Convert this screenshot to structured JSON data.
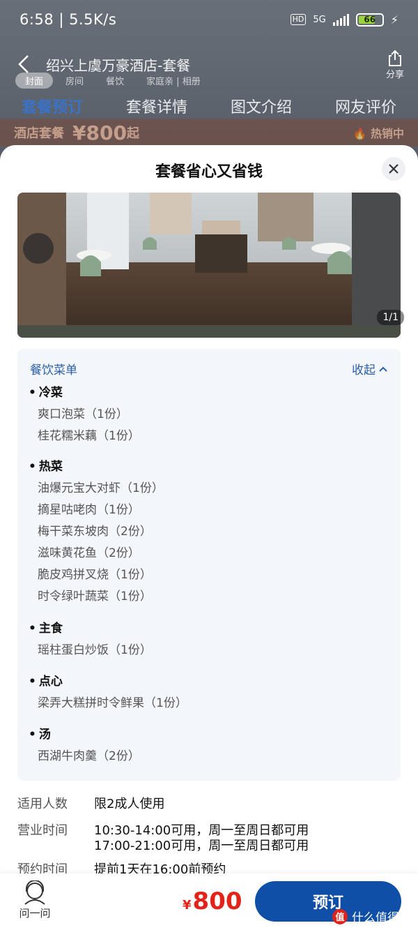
{
  "status_bar": {
    "time_speed": "6:58 | 5.5K/s",
    "hd": "HD",
    "network": "5G",
    "battery": "66"
  },
  "background_page": {
    "title": "绍兴上虞万豪酒店-套餐",
    "share_label": "分享",
    "gallery_tabs": [
      "封面",
      "房间",
      "餐饮",
      "家庭亲 | 相册"
    ],
    "section_tabs": [
      "套餐预订",
      "套餐详情",
      "图文介绍",
      "网友评价"
    ],
    "promo_label": "酒店套餐",
    "promo_price": "¥800",
    "promo_suffix": "起",
    "promo_hot": "热销中"
  },
  "sheet": {
    "title": "套餐省心又省钱",
    "photo_counter": "1/1",
    "menu": {
      "header": "餐饮菜单",
      "collapse_label": "收起",
      "categories": [
        {
          "name": "冷菜",
          "items": [
            "爽口泡菜（1份）",
            "桂花糯米藕（1份）"
          ]
        },
        {
          "name": "热菜",
          "items": [
            "油爆元宝大对虾（1份）",
            "摘星咕咾肉（1份）",
            "梅干菜东坡肉（2份）",
            "滋味黄花鱼（2份）",
            "脆皮鸡拼叉烧（1份）",
            "时令绿叶蔬菜（1份）"
          ]
        },
        {
          "name": "主食",
          "items": [
            "瑶柱蛋白炒饭（1份）"
          ]
        },
        {
          "name": "点心",
          "items": [
            "梁弄大糕拼时令鲜果（1份）"
          ]
        },
        {
          "name": "汤",
          "items": [
            "西湖牛肉羹（2份）"
          ]
        }
      ]
    },
    "info": {
      "people_label": "适用人数",
      "people_value": "限2成人使用",
      "hours_label": "营业时间",
      "hours_value_1": "10:30-14:00可用，周一至周日都可用",
      "hours_value_2": "17:00-21:00可用，周一至周日都可用",
      "reserve_label": "预约时间",
      "reserve_value": "提前1天在16:00前预约"
    }
  },
  "bottom_bar": {
    "ask_label": "问一问",
    "price_symbol": "¥",
    "price_value": "800",
    "book_label": "预订"
  },
  "watermark": {
    "badge": "值",
    "text": "什么值得买"
  },
  "colors": {
    "accent_blue": "#0f4fa8",
    "menu_text_blue": "#2b5fa8",
    "price_red": "#e2231a"
  }
}
